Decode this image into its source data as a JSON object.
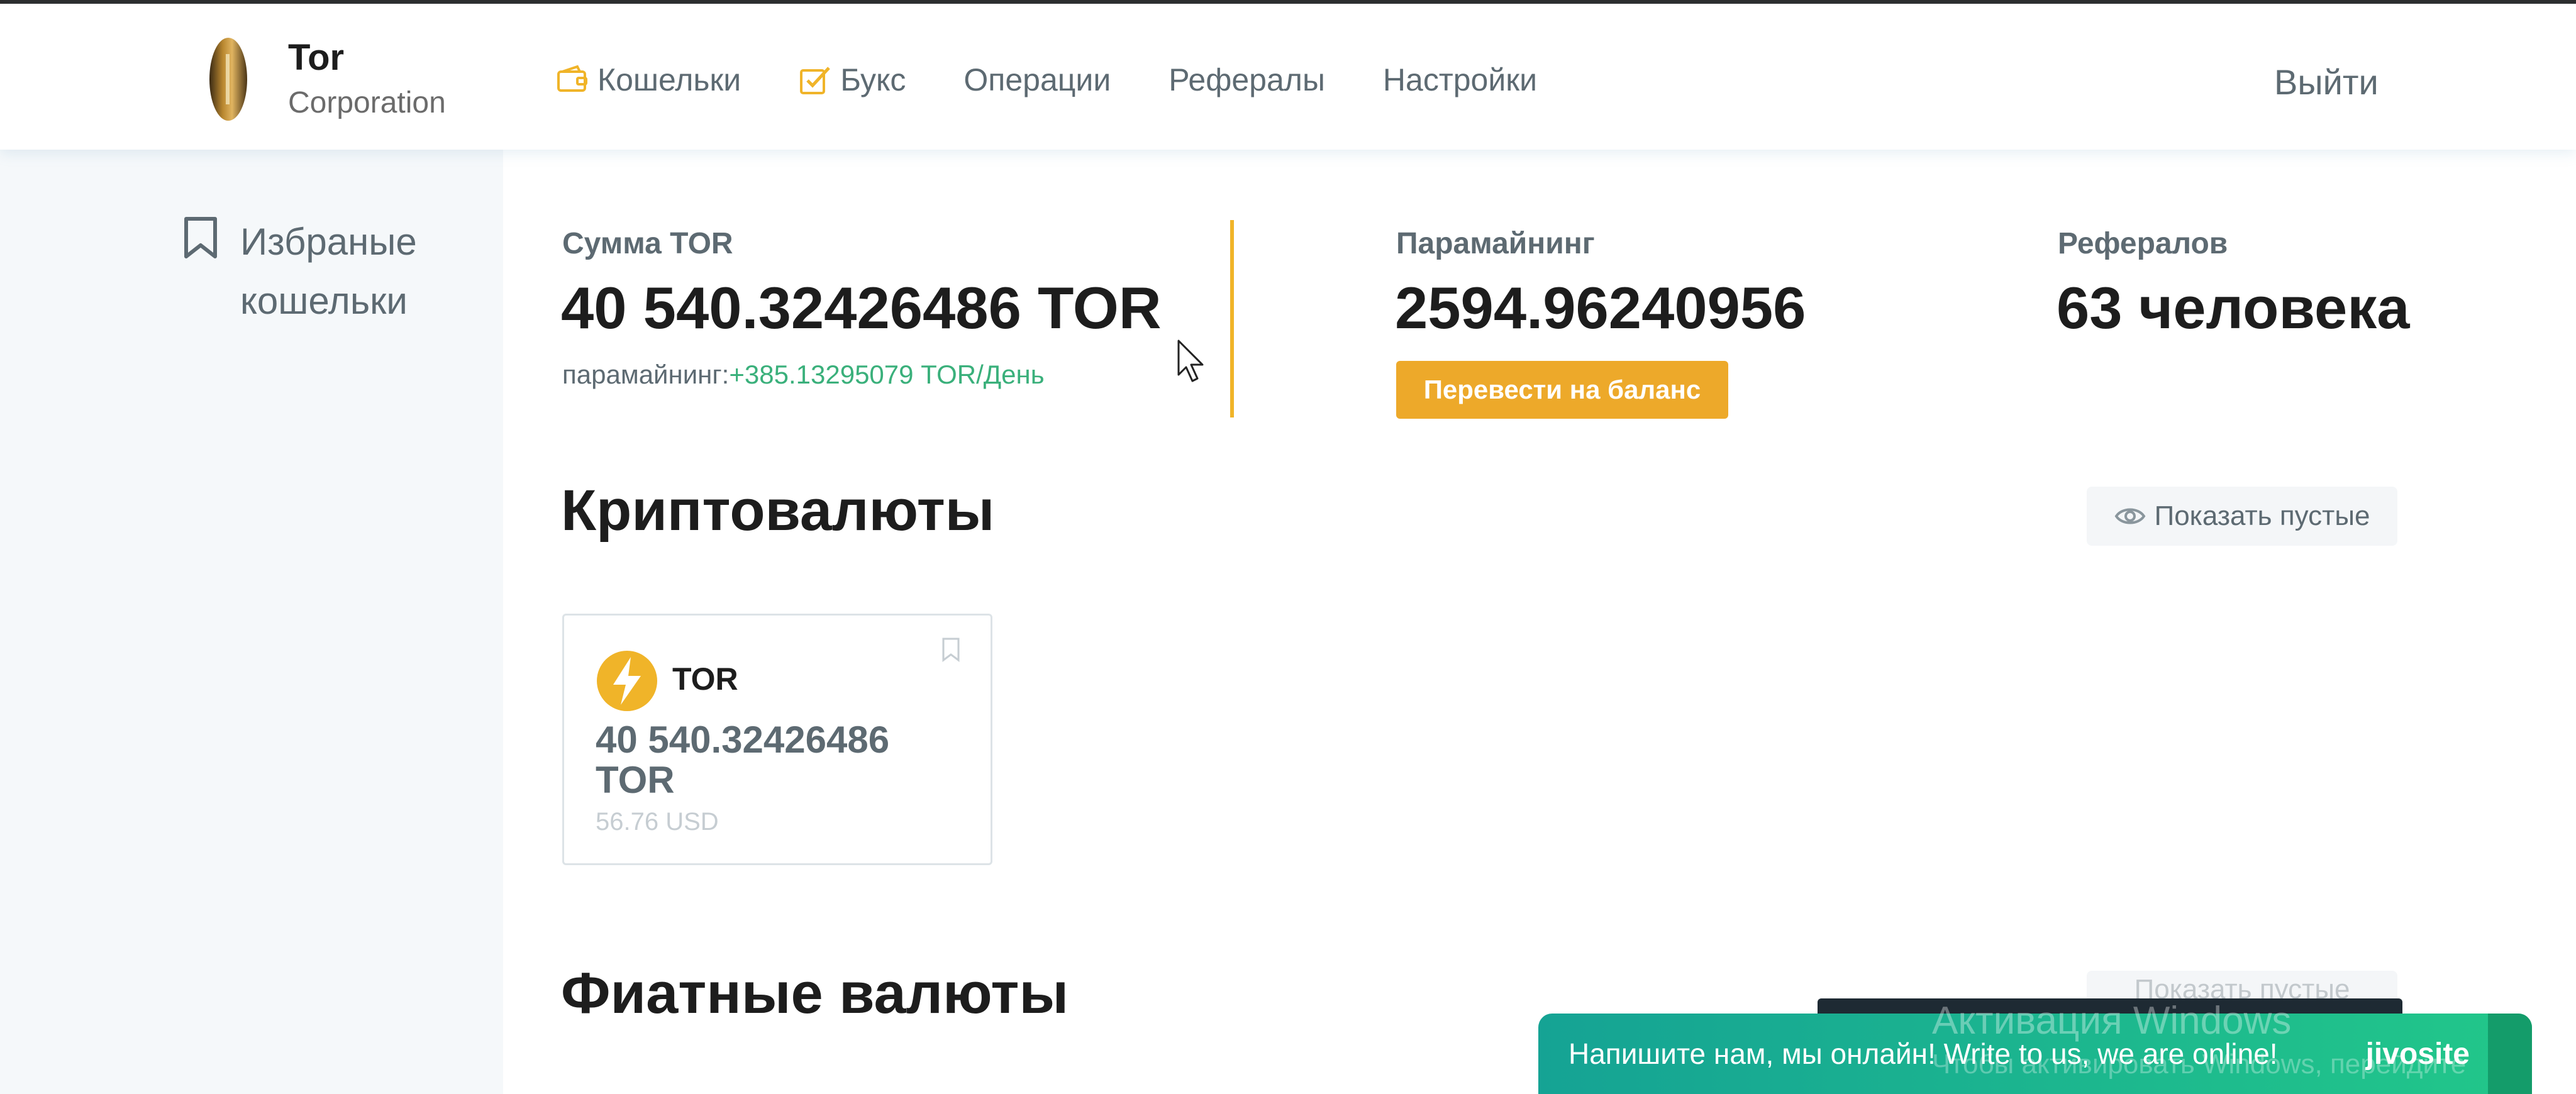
{
  "header": {
    "brand_name": "Tor",
    "brand_sub": "Corporation",
    "nav": [
      {
        "label": "Кошельки",
        "icon": "wallet-icon"
      },
      {
        "label": "Букс",
        "icon": "edit-check-icon"
      },
      {
        "label": "Операции"
      },
      {
        "label": "Рефералы"
      },
      {
        "label": "Настройки"
      }
    ],
    "logout": "Выйти"
  },
  "sidebar": {
    "favorites_label": "Избраные кошельки",
    "favorites_icon": "bookmark-icon"
  },
  "stats": {
    "sum": {
      "label": "Сумма TOR",
      "value": "40 540.32426486 TOR",
      "sub_prefix": "парамайнинг:",
      "sub_value": "+385.13295079 TOR/День"
    },
    "paramining": {
      "label": "Парамайнинг",
      "value": "2594.96240956",
      "button": "Перевести на баланс"
    },
    "referrals": {
      "label": "Рефералов",
      "value": "63 человека"
    }
  },
  "crypto": {
    "title": "Криптовалюты",
    "show_empty": "Показать пустые",
    "cards": [
      {
        "symbol": "TOR",
        "amount": "40 540.32426486 TOR",
        "usd": "56.76 USD",
        "icon": "lightning-icon"
      }
    ]
  },
  "fiat": {
    "title": "Фиатные валюты",
    "show_empty": "Показать пустые"
  },
  "chat": {
    "text": "Напишите нам, мы онлайн! Write to us, we are online!",
    "brand": "jivosite"
  },
  "watermark": {
    "line1": "Активация Windows",
    "line2": "Чтобы активировать Windows, перейдите"
  },
  "colors": {
    "accent": "#eda92a",
    "green": "#3ab07b",
    "sidebar_bg": "#f5f8fa"
  }
}
